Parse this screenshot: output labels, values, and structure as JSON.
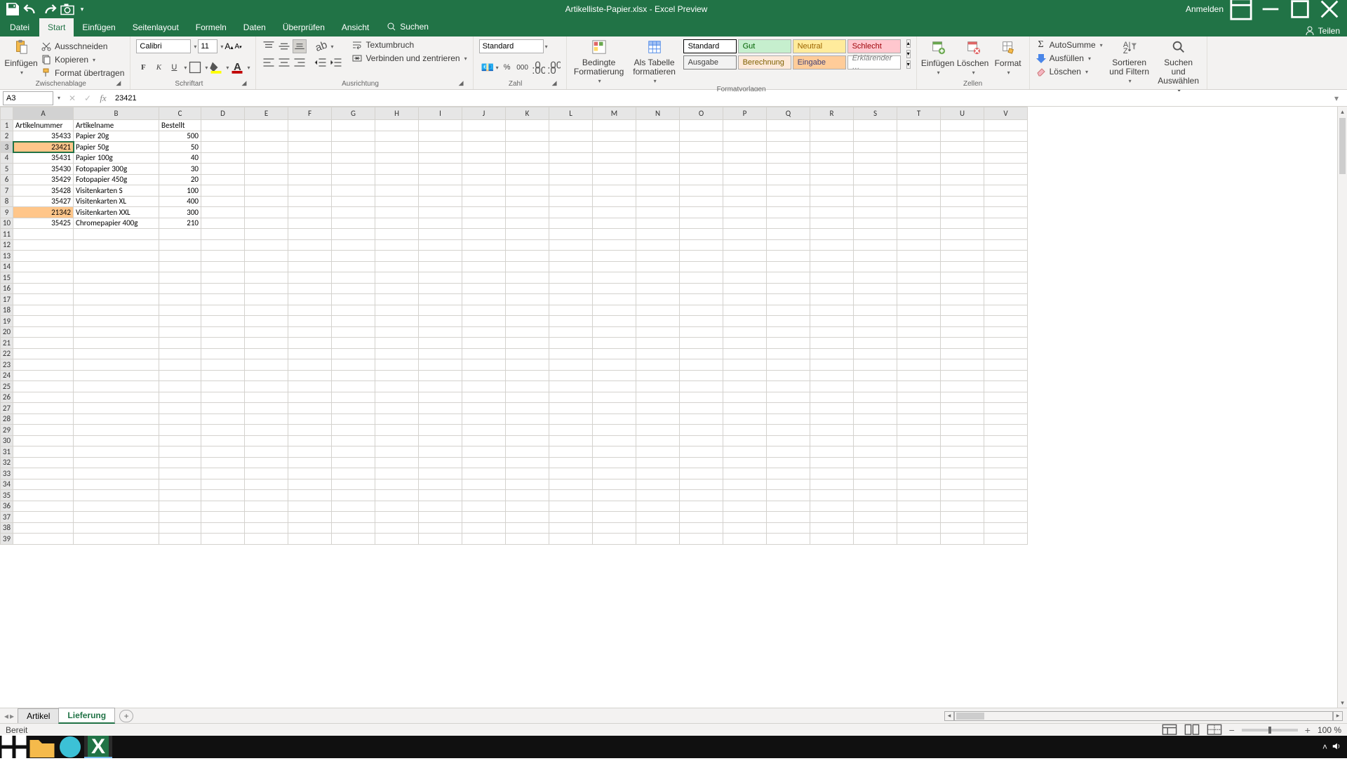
{
  "title": "Artikelliste-Papier.xlsx  -  Excel Preview",
  "titlebar": {
    "signin": "Anmelden"
  },
  "tabs": {
    "file": "Datei",
    "home": "Start",
    "insert": "Einfügen",
    "page": "Seitenlayout",
    "formulas": "Formeln",
    "data": "Daten",
    "review": "Überprüfen",
    "view": "Ansicht",
    "search_icon": "🔍",
    "search": "Suchen",
    "share": "Teilen"
  },
  "ribbon": {
    "clipboard": {
      "paste": "Einfügen",
      "cut": "Ausschneiden",
      "copy": "Kopieren",
      "format_painter": "Format übertragen",
      "group": "Zwischenablage"
    },
    "font": {
      "name": "Calibri",
      "size": "11",
      "group": "Schriftart"
    },
    "align": {
      "wrap": "Textumbruch",
      "merge": "Verbinden und zentrieren",
      "group": "Ausrichtung"
    },
    "number": {
      "format": "Standard",
      "group": "Zahl"
    },
    "cond": {
      "cond": "Bedingte Formatierung",
      "table": "Als Tabelle formatieren"
    },
    "styles": {
      "r1": [
        "Standard",
        "Gut",
        "Neutral",
        "Schlecht"
      ],
      "r2": [
        "Ausgabe",
        "Berechnung",
        "Eingabe",
        "Erklärender …"
      ],
      "group": "Formatvorlagen"
    },
    "cells": {
      "insert": "Einfügen",
      "delete": "Löschen",
      "format": "Format",
      "group": "Zellen"
    },
    "editing": {
      "autosum": "AutoSumme",
      "fill": "Ausfüllen",
      "clear": "Löschen",
      "sort": "Sortieren und Filtern",
      "find": "Suchen und Auswählen",
      "group": "Bearbeiten"
    }
  },
  "namebox": "A3",
  "formula_value": "23421",
  "columns": [
    "A",
    "B",
    "C",
    "D",
    "E",
    "F",
    "G",
    "H",
    "I",
    "J",
    "K",
    "L",
    "M",
    "N",
    "O",
    "P",
    "Q",
    "R",
    "S",
    "T",
    "U",
    "V"
  ],
  "headers": {
    "a": "Artikelnummer",
    "b": "Artikelname",
    "c": "Bestellt"
  },
  "rows": [
    {
      "n": "35433",
      "name": "Papier 20g",
      "q": "500",
      "hl": false
    },
    {
      "n": "23421",
      "name": "Papier 50g",
      "q": "50",
      "hl": true
    },
    {
      "n": "35431",
      "name": "Papier 100g",
      "q": "40",
      "hl": false
    },
    {
      "n": "35430",
      "name": "Fotopapier 300g",
      "q": "30",
      "hl": false
    },
    {
      "n": "35429",
      "name": "Fotopapier 450g",
      "q": "20",
      "hl": false
    },
    {
      "n": "35428",
      "name": "Visitenkarten S",
      "q": "100",
      "hl": false
    },
    {
      "n": "35427",
      "name": "Visitenkarten XL",
      "q": "400",
      "hl": false
    },
    {
      "n": "21342",
      "name": "Visitenkarten XXL",
      "q": "300",
      "hl": true
    },
    {
      "n": "35425",
      "name": "Chromepapier 400g",
      "q": "210",
      "hl": false
    }
  ],
  "selected_row_index": 1,
  "sheets": {
    "artikel": "Artikel",
    "lieferung": "Lieferung"
  },
  "status": {
    "ready": "Bereit",
    "zoom": "100 %"
  },
  "style_colors": {
    "r1": [
      {
        "bg": "#ffffff",
        "fg": "#000",
        "border": "#000"
      },
      {
        "bg": "#c6efce",
        "fg": "#006100",
        "border": "#adadad"
      },
      {
        "bg": "#ffeb9c",
        "fg": "#9c6500",
        "border": "#adadad"
      },
      {
        "bg": "#ffc7ce",
        "fg": "#9c0006",
        "border": "#adadad"
      }
    ],
    "r2": [
      {
        "bg": "#f2f2f2",
        "fg": "#3f3f3f",
        "border": "#7f7f7f"
      },
      {
        "bg": "#fde9d9",
        "fg": "#7f6000",
        "border": "#adadad"
      },
      {
        "bg": "#ffcc99",
        "fg": "#3f3f76",
        "border": "#adadad"
      },
      {
        "bg": "#ffffff",
        "fg": "#7f7f7f",
        "border": "#adadad"
      }
    ]
  }
}
